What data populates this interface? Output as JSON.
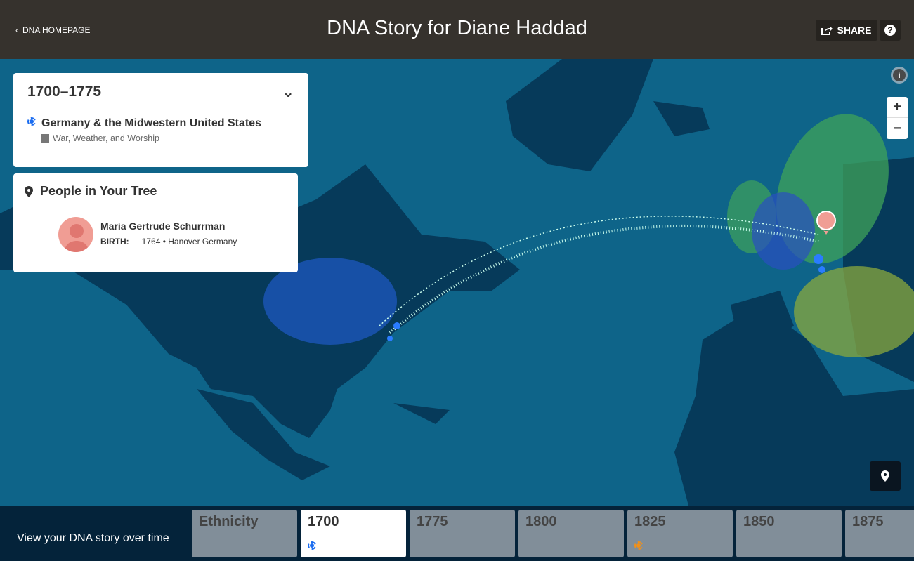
{
  "header": {
    "back_label": "DNA HOMEPAGE",
    "title": "DNA Story for Diane Haddad",
    "share_label": "SHARE",
    "help_label": "?"
  },
  "era_panel": {
    "range": "1700–1775",
    "story_title": "Germany & the Midwestern United States",
    "story_subtitle": "War, Weather, and Worship"
  },
  "people_panel": {
    "title": "People in Your Tree",
    "people": [
      {
        "name": "Maria Gertrude Schurrman",
        "birth_label": "BIRTH:",
        "birth_value": "1764 • Hanover Germany"
      }
    ]
  },
  "map_controls": {
    "zoom_in": "+",
    "zoom_out": "−",
    "info": "i"
  },
  "timeline": {
    "label": "View your DNA story over time",
    "tabs": [
      {
        "label": "Ethnicity",
        "active": false,
        "marker": null
      },
      {
        "label": "1700",
        "active": true,
        "marker": "#1a6cf0"
      },
      {
        "label": "1775",
        "active": false,
        "marker": null
      },
      {
        "label": "1800",
        "active": false,
        "marker": null
      },
      {
        "label": "1825",
        "active": false,
        "marker": "#f0901a"
      },
      {
        "label": "1850",
        "active": false,
        "marker": null
      },
      {
        "label": "1875",
        "active": false,
        "marker": null
      }
    ]
  },
  "colors": {
    "header": "#36322d",
    "ocean": "#0e6489",
    "land": "#063a5a",
    "timeline": "#04233a",
    "accent": "#1a6cf0"
  }
}
